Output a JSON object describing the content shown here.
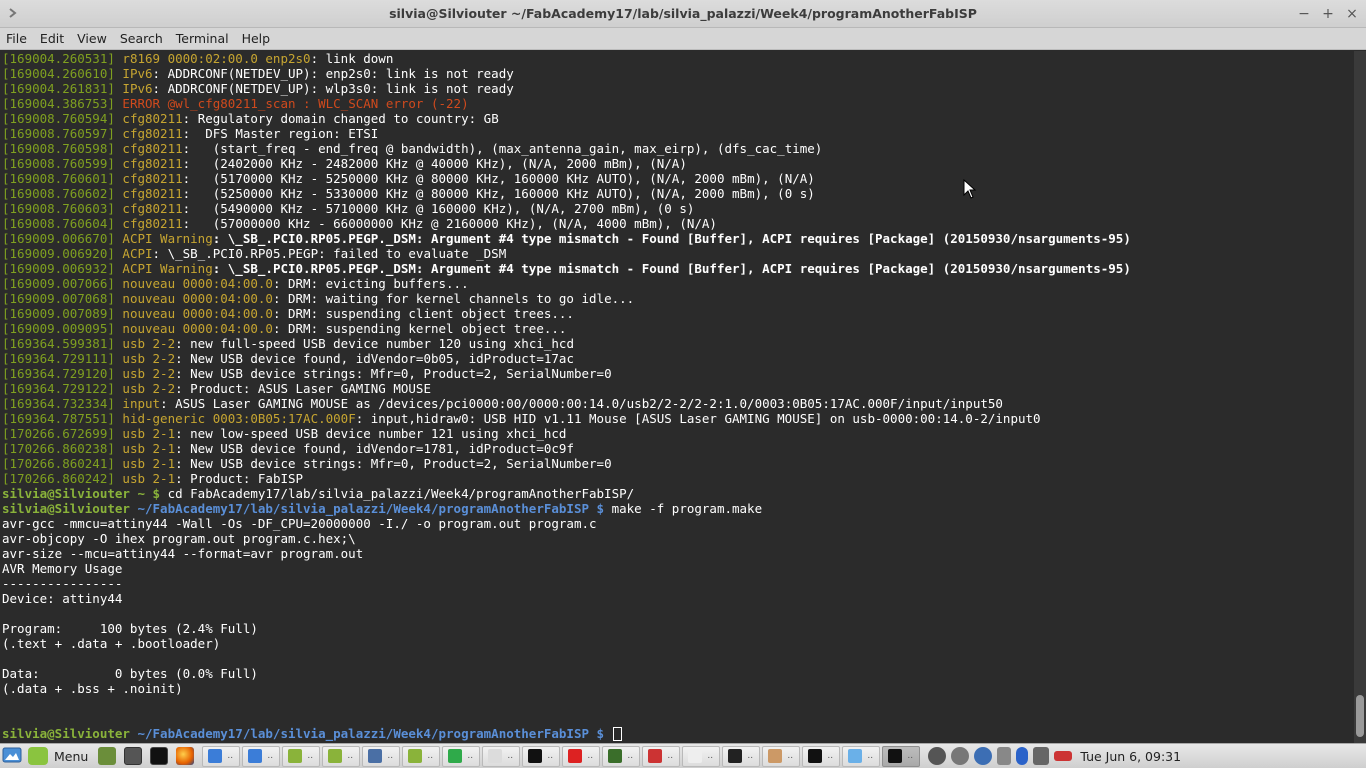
{
  "window": {
    "title": "silvia@Silviouter ~/FabAcademy17/lab/silvia_palazzi/Week4/programAnotherFabISP",
    "minimize": "−",
    "maximize": "+",
    "close": "×"
  },
  "menu": [
    "File",
    "Edit",
    "View",
    "Search",
    "Terminal",
    "Help"
  ],
  "terminal": {
    "log": [
      {
        "ts": "[169004.260531]",
        "src": "r8169 0000:02:00.0 enp2s0",
        "msg": ": link down"
      },
      {
        "ts": "[169004.260610]",
        "src": "IPv6",
        "msg": ": ADDRCONF(NETDEV_UP): enp2s0: link is not ready"
      },
      {
        "ts": "[169004.261831]",
        "src": "IPv6",
        "msg": ": ADDRCONF(NETDEV_UP): wlp3s0: link is not ready"
      },
      {
        "ts": "[169004.386753]",
        "src": "ERROR @wl_cfg80211_scan : WLC_SCAN error (-22)",
        "msg": "",
        "error": true
      },
      {
        "ts": "[169008.760594]",
        "src": "cfg80211",
        "msg": ": Regulatory domain changed to country: GB"
      },
      {
        "ts": "[169008.760597]",
        "src": "cfg80211",
        "msg": ":  DFS Master region: ETSI"
      },
      {
        "ts": "[169008.760598]",
        "src": "cfg80211",
        "msg": ":   (start_freq - end_freq @ bandwidth), (max_antenna_gain, max_eirp), (dfs_cac_time)"
      },
      {
        "ts": "[169008.760599]",
        "src": "cfg80211",
        "msg": ":   (2402000 KHz - 2482000 KHz @ 40000 KHz), (N/A, 2000 mBm), (N/A)"
      },
      {
        "ts": "[169008.760601]",
        "src": "cfg80211",
        "msg": ":   (5170000 KHz - 5250000 KHz @ 80000 KHz, 160000 KHz AUTO), (N/A, 2000 mBm), (N/A)"
      },
      {
        "ts": "[169008.760602]",
        "src": "cfg80211",
        "msg": ":   (5250000 KHz - 5330000 KHz @ 80000 KHz, 160000 KHz AUTO), (N/A, 2000 mBm), (0 s)"
      },
      {
        "ts": "[169008.760603]",
        "src": "cfg80211",
        "msg": ":   (5490000 KHz - 5710000 KHz @ 160000 KHz), (N/A, 2700 mBm), (0 s)"
      },
      {
        "ts": "[169008.760604]",
        "src": "cfg80211",
        "msg": ":   (57000000 KHz - 66000000 KHz @ 2160000 KHz), (N/A, 4000 mBm), (N/A)"
      },
      {
        "ts": "[169009.006670]",
        "src": "ACPI Warning",
        "msg": ": \\_SB_.PCI0.RP05.PEGP._DSM: Argument #4 type mismatch - Found [Buffer], ACPI requires [Package] (20150930/nsarguments-95)",
        "bold": true
      },
      {
        "ts": "[169009.006920]",
        "src": "ACPI",
        "msg": ": \\_SB_.PCI0.RP05.PEGP: failed to evaluate _DSM"
      },
      {
        "ts": "[169009.006932]",
        "src": "ACPI Warning",
        "msg": ": \\_SB_.PCI0.RP05.PEGP._DSM: Argument #4 type mismatch - Found [Buffer], ACPI requires [Package] (20150930/nsarguments-95)",
        "bold": true
      },
      {
        "ts": "[169009.007066]",
        "src": "nouveau 0000:04:00.0",
        "msg": ": DRM: evicting buffers..."
      },
      {
        "ts": "[169009.007068]",
        "src": "nouveau 0000:04:00.0",
        "msg": ": DRM: waiting for kernel channels to go idle..."
      },
      {
        "ts": "[169009.007089]",
        "src": "nouveau 0000:04:00.0",
        "msg": ": DRM: suspending client object trees..."
      },
      {
        "ts": "[169009.009095]",
        "src": "nouveau 0000:04:00.0",
        "msg": ": DRM: suspending kernel object tree..."
      },
      {
        "ts": "[169364.599381]",
        "src": "usb 2-2",
        "msg": ": new full-speed USB device number 120 using xhci_hcd"
      },
      {
        "ts": "[169364.729111]",
        "src": "usb 2-2",
        "msg": ": New USB device found, idVendor=0b05, idProduct=17ac"
      },
      {
        "ts": "[169364.729120]",
        "src": "usb 2-2",
        "msg": ": New USB device strings: Mfr=0, Product=2, SerialNumber=0"
      },
      {
        "ts": "[169364.729122]",
        "src": "usb 2-2",
        "msg": ": Product: ASUS Laser GAMING MOUSE"
      },
      {
        "ts": "[169364.732334]",
        "src": "input",
        "msg": ": ASUS Laser GAMING MOUSE as /devices/pci0000:00/0000:00:14.0/usb2/2-2/2-2:1.0/0003:0B05:17AC.000F/input/input50"
      },
      {
        "ts": "[169364.787551]",
        "src": "hid-generic 0003:0B05:17AC.000F",
        "msg": ": input,hidraw0: USB HID v1.11 Mouse [ASUS Laser GAMING MOUSE] on usb-0000:00:14.0-2/input0"
      },
      {
        "ts": "[170266.672699]",
        "src": "usb 2-1",
        "msg": ": new low-speed USB device number 121 using xhci_hcd"
      },
      {
        "ts": "[170266.860238]",
        "src": "usb 2-1",
        "msg": ": New USB device found, idVendor=1781, idProduct=0c9f"
      },
      {
        "ts": "[170266.860241]",
        "src": "usb 2-1",
        "msg": ": New USB device strings: Mfr=0, Product=2, SerialNumber=0"
      },
      {
        "ts": "[170266.860242]",
        "src": "usb 2-1",
        "msg": ": Product: FabISP"
      }
    ],
    "cmd1": {
      "user": "silvia@Silviouter",
      "path": " ~ $",
      "cmd": " cd FabAcademy17/lab/silvia_palazzi/Week4/programAnotherFabISP/"
    },
    "cmd2": {
      "user": "silvia@Silviouter",
      "path": " ~/FabAcademy17/lab/silvia_palazzi/Week4/programAnotherFabISP $",
      "cmd": " make -f program.make"
    },
    "output": [
      "avr-gcc -mmcu=attiny44 -Wall -Os -DF_CPU=20000000 -I./ -o program.out program.c",
      "avr-objcopy -O ihex program.out program.c.hex;\\",
      "avr-size --mcu=attiny44 --format=avr program.out",
      "AVR Memory Usage",
      "----------------",
      "Device: attiny44",
      "",
      "Program:     100 bytes (2.4% Full)",
      "(.text + .data + .bootloader)",
      "",
      "Data:          0 bytes (0.0% Full)",
      "(.data + .bss + .noinit)",
      "",
      ""
    ],
    "cmd3": {
      "user": "silvia@Silviouter",
      "path": " ~/FabAcademy17/lab/silvia_palazzi/Week4/programAnotherFabISP $",
      "cmd": " "
    }
  },
  "panel": {
    "menu_label": "Menu",
    "clock": "Tue Jun  6, 09:31",
    "task_dots": ".."
  }
}
